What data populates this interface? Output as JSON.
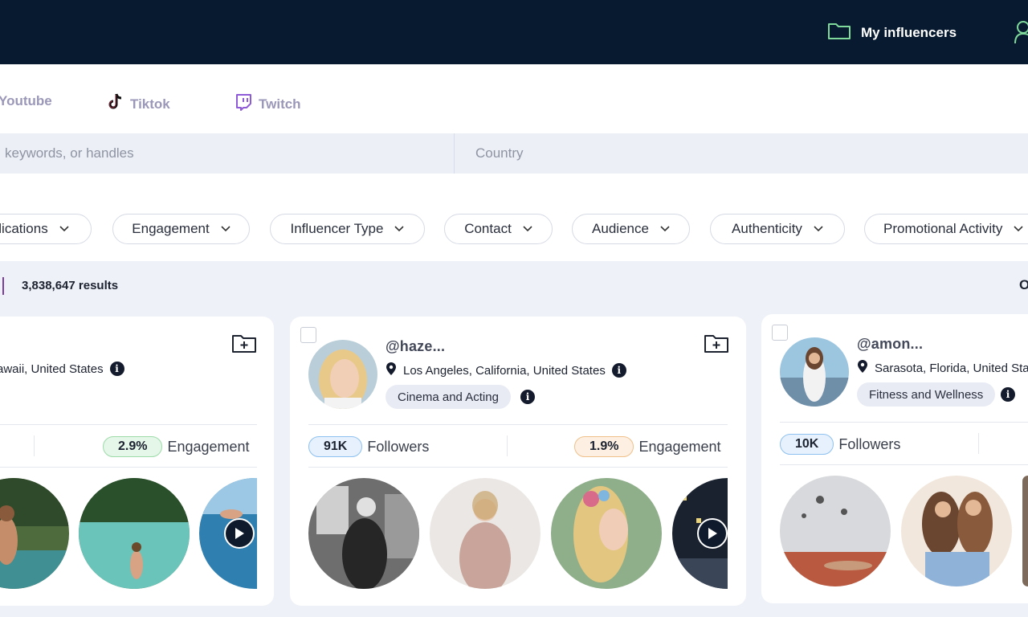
{
  "header": {
    "my_influencers_label": "My influencers",
    "colors": {
      "bg": "#071a2f",
      "icon": "#7fd99a"
    }
  },
  "platform_tabs": [
    {
      "label": "Youtube",
      "icon": "youtube-icon"
    },
    {
      "label": "Tiktok",
      "icon": "tiktok-icon"
    },
    {
      "label": "Twitch",
      "icon": "twitch-icon"
    }
  ],
  "search": {
    "keywords_placeholder": "keywords, or handles",
    "country_placeholder": "Country"
  },
  "filters": [
    {
      "label": "lications"
    },
    {
      "label": "Engagement"
    },
    {
      "label": "Influencer Type"
    },
    {
      "label": "Contact"
    },
    {
      "label": "Audience"
    },
    {
      "label": "Authenticity"
    },
    {
      "label": "Promotional Activity"
    }
  ],
  "results": {
    "count_text": "3,838,647 results",
    "right_text": "O"
  },
  "cards": [
    {
      "handle": "",
      "location": "awaii, United States",
      "engagement": "2.9%",
      "engagement_label": "Engagement",
      "engagement_color": "green"
    },
    {
      "handle": "@haze...",
      "location": "Los Angeles, California, United States",
      "category": "Cinema and Acting",
      "followers": "91K",
      "followers_label": "Followers",
      "engagement": "1.9%",
      "engagement_label": "Engagement",
      "engagement_color": "orange"
    },
    {
      "handle": "@amon...",
      "location": "Sarasota, Florida, United Sta",
      "category": "Fitness and Wellness",
      "followers": "10K",
      "followers_label": "Followers"
    }
  ]
}
